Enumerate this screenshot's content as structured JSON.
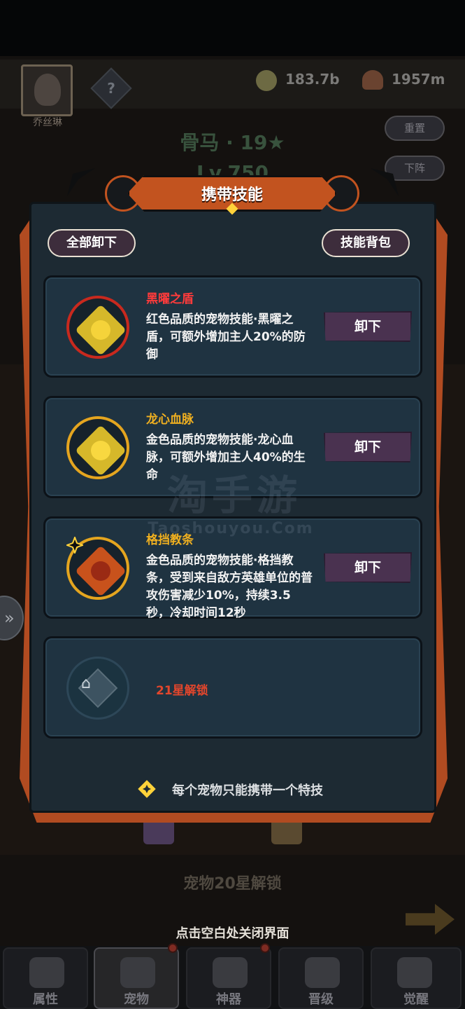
{
  "background": {
    "avatar_name": "乔丝琳",
    "mystery_icon_text": "?",
    "currency": [
      {
        "icon": "gold-coin-icon",
        "value": "183.7b"
      },
      {
        "icon": "mushroom-icon",
        "value": "1957m"
      }
    ],
    "buttons": {
      "reset": "重置",
      "unequip": "下阵"
    },
    "pet_title": "骨马 · 19★",
    "pet_level": "Lv.750",
    "unlock_text": "宠物20星解锁",
    "close_hint": "点击空白处关闭界面"
  },
  "bottom_nav": [
    {
      "label": "属性",
      "icon": "fist-icon",
      "active": false
    },
    {
      "label": "宠物",
      "icon": "paw-icon",
      "active": true
    },
    {
      "label": "神器",
      "icon": "artifact-icon",
      "active": false
    },
    {
      "label": "晋级",
      "icon": "rank-up-icon",
      "active": false
    },
    {
      "label": "觉醒",
      "icon": "awaken-icon",
      "active": false
    }
  ],
  "dialog": {
    "title": "携带技能",
    "unload_all_label": "全部卸下",
    "skill_bag_label": "技能背包",
    "skills": [
      {
        "name": "黑曜之盾",
        "name_color": "#ff3b3b",
        "description": "红色品质的宠物技能·黑曜之盾，可额外增加主人20%的防御",
        "button_label": "卸下",
        "icon": "shield-icon",
        "ring_color": "#c8291e",
        "gem_color": "#d6b82a",
        "inner_color": "#f5d33a"
      },
      {
        "name": "龙心血脉",
        "name_color": "#f0b020",
        "description": "金色品质的宠物技能·龙心血脉，可额外增加主人40%的生命",
        "button_label": "卸下",
        "icon": "heart-icon",
        "ring_color": "#e4a51f",
        "gem_color": "#d6b82a",
        "inner_color": "#f8d840"
      },
      {
        "name": "格挡教条",
        "name_color": "#f0b020",
        "description": "金色品质的宠物技能·格挡教条，受到来自敌方英雄单位的普攻伤害减少10%，持续3.5秒，冷却时间12秒",
        "button_label": "卸下",
        "icon": "block-doctrine-icon",
        "ring_color": "#e4a51f",
        "gem_color": "#c8521c",
        "inner_color": "#9a2a14"
      }
    ],
    "locked_slot": {
      "text": "21星解锁",
      "icon": "lock-icon"
    },
    "tip": "每个宠物只能携带一个特技"
  },
  "watermark": {
    "main": "淘手游",
    "sub": "Taoshouyou.Com"
  }
}
